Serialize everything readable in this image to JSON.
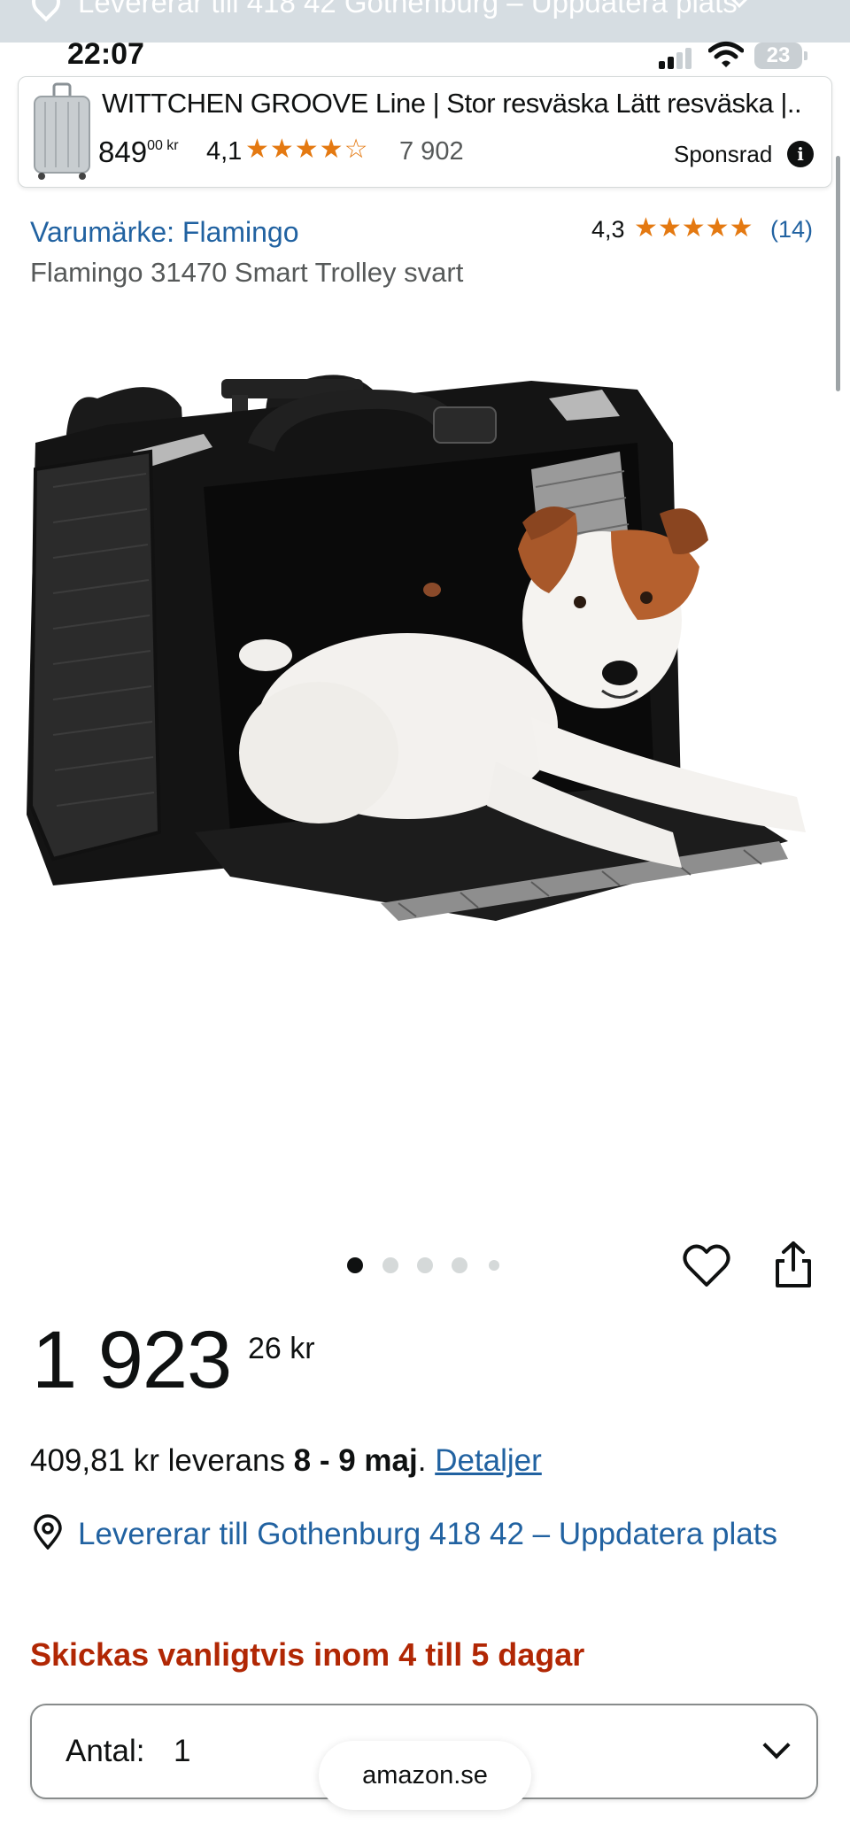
{
  "location_bar": {
    "text": "Levererar till 418 42 Gothenburg – Uppdatera plats"
  },
  "status_bar": {
    "time": "22:07",
    "battery": "23"
  },
  "ad": {
    "title": "WITTCHEN GROOVE Line | Stor resväska Lätt resväska |...",
    "price_main": "849",
    "price_sup": "00 kr",
    "rating": "4,1",
    "stars": "★★★★☆",
    "rating_count": "7 902",
    "sponsored": "Sponsrad",
    "info_icon": "i"
  },
  "product": {
    "brand": "Varumärke: Flamingo",
    "title": "Flamingo 31470 Smart Trolley svart",
    "rating": "4,3",
    "stars": "★★★★★",
    "rating_count": "(14)",
    "image_count": 5,
    "active_image": 0
  },
  "price": {
    "main": "1 923",
    "sup": "26 kr"
  },
  "delivery": {
    "prefix": "409,81 kr leverans ",
    "dates": "8 - 9 maj",
    "dot": ". ",
    "link": "Detaljer"
  },
  "location": {
    "text": "Levererar till Gothenburg 418 42 – Uppdatera plats"
  },
  "shipping": {
    "text": "Skickas vanligtvis inom 4 till 5 dagar"
  },
  "quantity": {
    "label": "Antal:",
    "value": "1"
  },
  "browser": {
    "url": "amazon.se"
  },
  "colors": {
    "link": "#2162a1",
    "star": "#e47911",
    "alert": "#b12704",
    "text": "#0f1111"
  }
}
